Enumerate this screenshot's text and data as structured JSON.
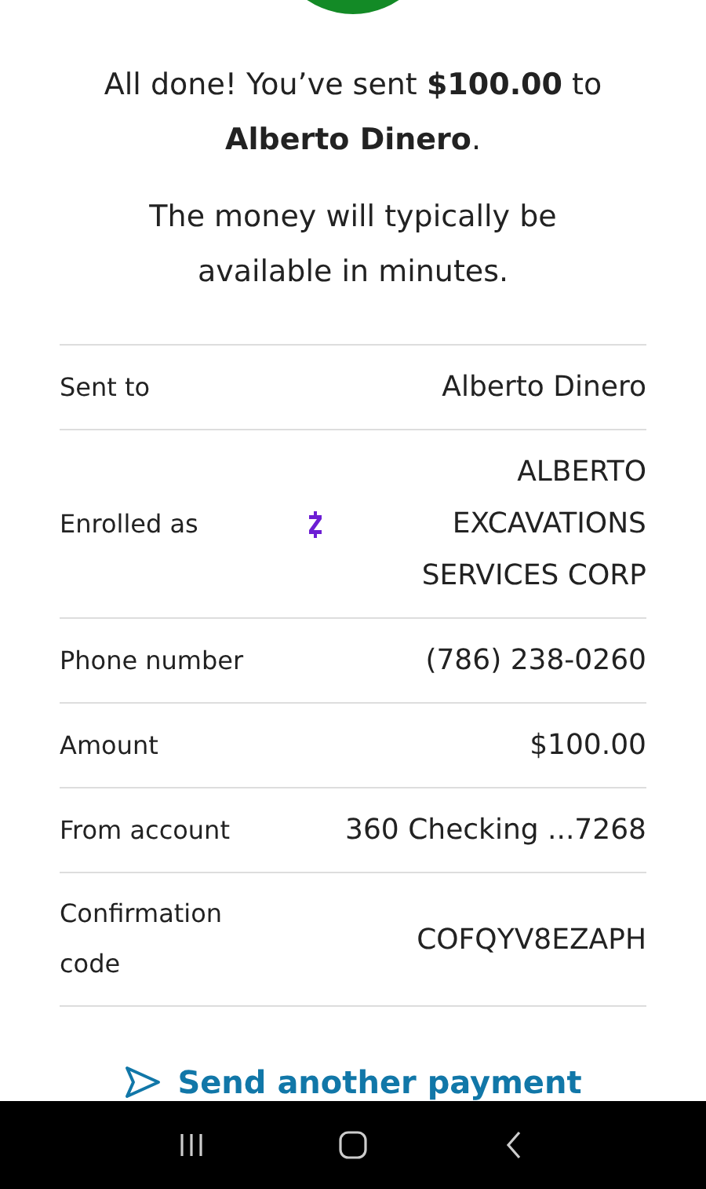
{
  "message": "All done! You’ve sent **$100.00** to **Alberto Dinero**.",
  "note": "The money will typically be available in minutes.",
  "details": [
    {
      "kind": "plain",
      "label": "Sent to",
      "value": "Alberto Dinero"
    },
    {
      "kind": "enrolled",
      "label": "Enrolled as",
      "value": "ALBERTO EXCAVATIONS SERVICES CORP"
    },
    {
      "kind": "plain",
      "label": "Phone number",
      "value": "(786) 238-0260"
    },
    {
      "kind": "plain",
      "label": "Amount",
      "value": "$100.00"
    },
    {
      "kind": "plain",
      "label": "From account",
      "value": "360 Checking ...7268"
    },
    {
      "kind": "plain",
      "label": "Confirmation code",
      "value": "COFQYV8EZAPH"
    }
  ],
  "link": {
    "label": "Send another payment"
  }
}
